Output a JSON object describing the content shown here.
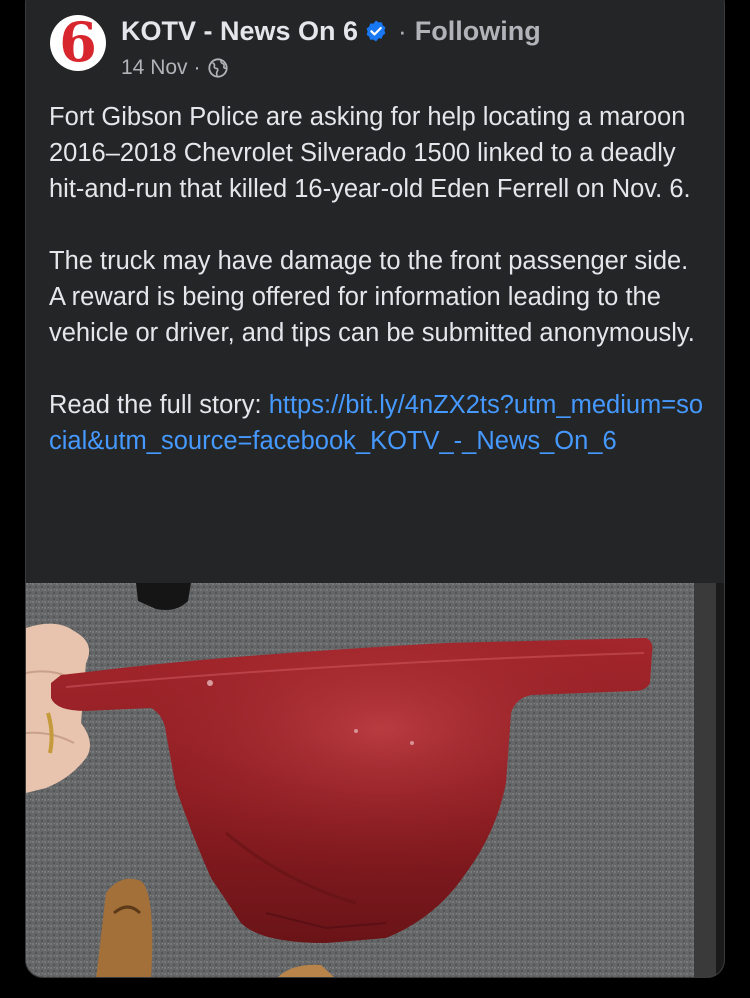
{
  "post": {
    "page_name": "KOTV - News On 6",
    "avatar_text": "6",
    "separator": "·",
    "follow_status": "Following",
    "date": "14 Nov",
    "date_separator": "·",
    "paragraph_1": "Fort Gibson Police are asking for help locating a maroon 2016–2018 Chevrolet Silverado 1500 linked to a deadly hit-and-run that killed 16-year-old Eden Ferrell on Nov. 6.",
    "paragraph_2": "The truck may have damage to the front passenger side. A reward is being offered for information leading to the vehicle or driver, and tips can be submitted anonymously.",
    "read_more_prefix": "Read the full story: ",
    "story_link": "https://bit.ly/4nZX2ts?utm_medium=social&utm_source=facebook_KOTV_-_News_On_6"
  },
  "icons": {
    "verified": "verified-badge-icon",
    "audience": "globe-icon"
  },
  "colors": {
    "background": "#000000",
    "card": "#242526",
    "text_primary": "#e4e6eb",
    "text_secondary": "#b0b3b8",
    "link": "#4599ff",
    "verified_blue": "#1877f2",
    "brand_red": "#d8262e",
    "truck_part_maroon": "#8e1d22"
  }
}
